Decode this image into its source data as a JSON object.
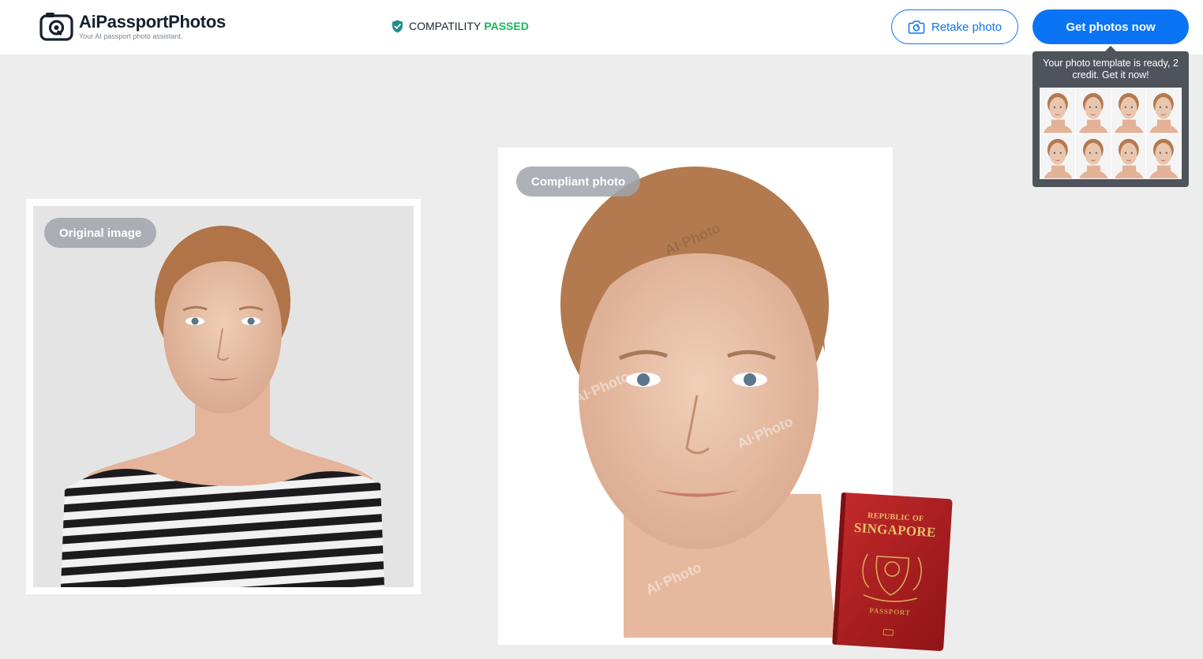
{
  "app": {
    "name": "AiPassportPhotos",
    "tagline": "Your AI passport photo assistant."
  },
  "status": {
    "label": "COMPATILITY",
    "value": "PASSED",
    "value_color": "#1db45a"
  },
  "actions": {
    "retake_label": "Retake photo",
    "get_label": "Get photos now"
  },
  "tooltip": {
    "text": "Your photo template is ready, 2 credit. Get it now!",
    "thumbnail_rows": 2,
    "thumbnail_cols": 4
  },
  "original": {
    "badge": "Original image"
  },
  "compliant": {
    "badge": "Compliant photo",
    "watermark": "AI·Photo"
  },
  "passport": {
    "line1": "REPUBLIC OF",
    "line2": "SINGAPORE",
    "line3": "PASSPORT"
  },
  "colors": {
    "accent": "#0a74f5",
    "header_bg": "#ffffff",
    "page_bg": "#ededed",
    "passport_red": "#b01f22",
    "badge_bg": "#a0a3aa"
  },
  "icons": {
    "logo": "camera-logo-icon",
    "status": "shield-check-icon",
    "retake": "camera-refresh-icon"
  }
}
